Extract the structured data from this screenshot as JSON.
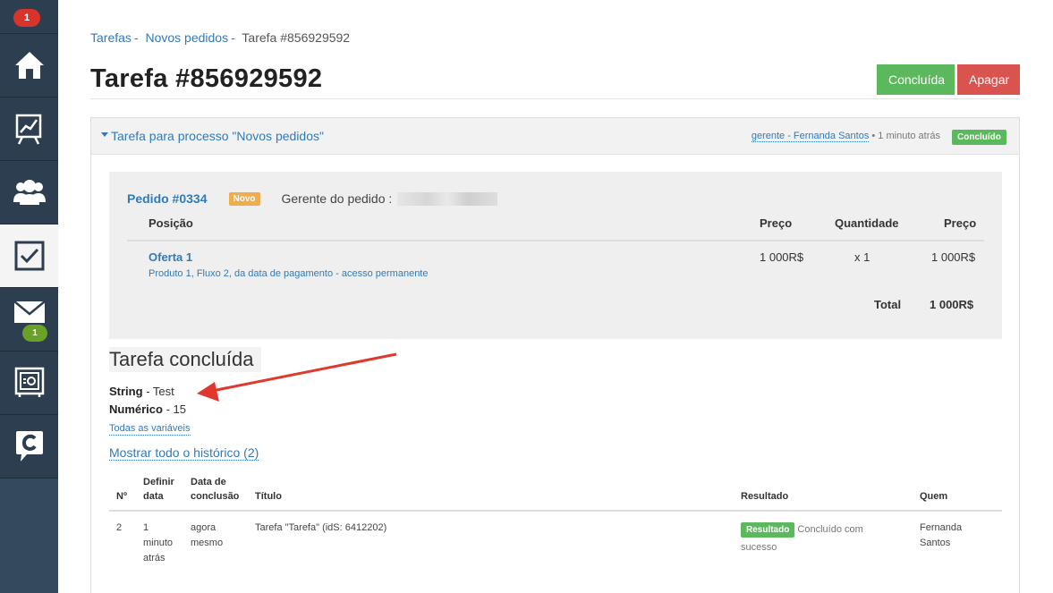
{
  "sidebar": {
    "notifications_badge": "1",
    "mail_badge": "1",
    "items": [
      {
        "icon": "home-icon"
      },
      {
        "icon": "chart-icon"
      },
      {
        "icon": "users-icon"
      },
      {
        "icon": "tasks-check-icon",
        "active": true
      },
      {
        "icon": "mail-icon"
      },
      {
        "icon": "safe-icon"
      },
      {
        "icon": "chat-icon"
      }
    ]
  },
  "breadcrumb": {
    "items": [
      "Tarefas",
      "Novos pedidos"
    ],
    "separator": "-",
    "current": "Tarefa #856929592"
  },
  "header": {
    "title": "Tarefa #856929592",
    "done_button": "Concluída",
    "delete_button": "Apagar"
  },
  "panel": {
    "title": "Tarefa para processo \"Novos pedidos\"",
    "manager": "gerente - Fernanda Santos",
    "time": "• 1 minuto atrás",
    "status": "Concluído"
  },
  "order": {
    "id": "Pedido #0334",
    "status": "Novo",
    "manager_label": "Gerente do pedido :",
    "columns": [
      "Posição",
      "Preço",
      "Quantidade",
      "Preço"
    ],
    "items": [
      {
        "name": "Oferta 1",
        "desc": "Produto 1, Fluxo 2, da data de pagamento - acesso permanente",
        "price": "1 000R$",
        "qty": "x 1",
        "total": "1 000R$"
      }
    ],
    "total_label": "Total",
    "total_value": "1 000R$"
  },
  "result": {
    "heading": "Tarefa concluída",
    "vars": [
      {
        "name": "String",
        "value": "- Test"
      },
      {
        "name": "Numérico",
        "value": "- 15"
      }
    ],
    "all_vars_link": "Todas as variáveis",
    "history_link": "Mostrar todo o histórico (2)"
  },
  "history_table": {
    "columns": [
      "Nº",
      "Definir data",
      "Data de conclusão",
      "Título",
      "Resultado",
      "Quem"
    ],
    "rows": [
      {
        "n": "2",
        "set_date": "1 minuto atrás",
        "done_date": "agora mesmo",
        "title": "Tarefa \"Tarefa\" (idS: 6412202)",
        "result_label": "Resultado",
        "result_text": "Concluído com sucesso",
        "who": "Fernanda Santos"
      }
    ]
  },
  "colors": {
    "sidebar": "#2d3e50",
    "accent": "#337ab7",
    "success": "#5cb85c",
    "danger": "#d9534f",
    "warning": "#f0ad4e",
    "arrow": "#e0382e"
  }
}
